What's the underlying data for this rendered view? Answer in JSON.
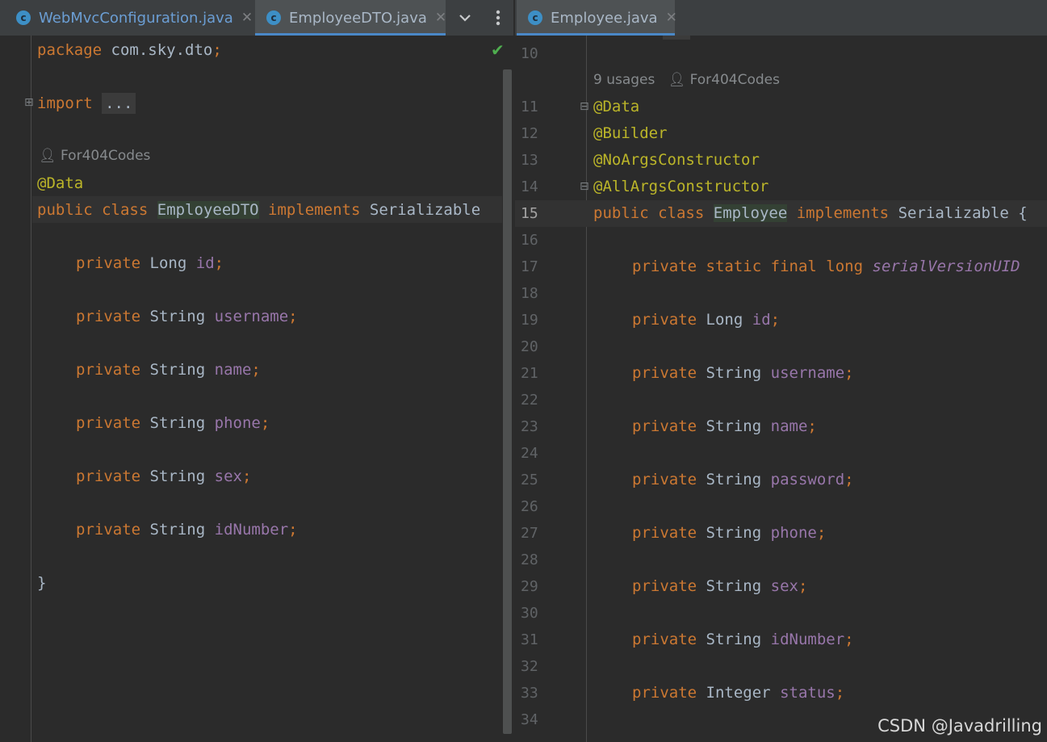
{
  "left_tabs": [
    {
      "label": "WebMvcConfiguration.java",
      "icon": "class-icon",
      "active": false
    },
    {
      "label": "EmployeeDTO.java",
      "icon": "class-icon",
      "active": true
    }
  ],
  "right_tabs": [
    {
      "label": "Employee.java",
      "icon": "class-icon",
      "active": true
    }
  ],
  "tab_icon_letter": "c",
  "close_glyph": "✕",
  "left_editor": {
    "lines": {
      "l1": {
        "kw": "package",
        "rest": " com.sky.dto",
        "semi": ";"
      },
      "l2": {
        "kw": "import",
        "fold": "..."
      },
      "l3": {
        "hint_user": "For404Codes"
      },
      "l4": {
        "ann": "@Data"
      },
      "l5": {
        "kw1": "public",
        "kw2": "class",
        "name": "EmployeeDTO",
        "kw3": "implements",
        "iface": "Serializable"
      },
      "l6": {
        "kw": "private",
        "type": "Long",
        "field": "id",
        "semi": ";"
      },
      "l7": {
        "kw": "private",
        "type": "String",
        "field": "username",
        "semi": ";"
      },
      "l8": {
        "kw": "private",
        "type": "String",
        "field": "name",
        "semi": ";"
      },
      "l9": {
        "kw": "private",
        "type": "String",
        "field": "phone",
        "semi": ";"
      },
      "l10": {
        "kw": "private",
        "type": "String",
        "field": "sex",
        "semi": ";"
      },
      "l11": {
        "kw": "private",
        "type": "String",
        "field": "idNumber",
        "semi": ";"
      },
      "l12": {
        "brace": "}"
      }
    }
  },
  "right_editor": {
    "line_numbers": [
      "10",
      "11",
      "12",
      "13",
      "14",
      "15",
      "16",
      "17",
      "18",
      "19",
      "20",
      "21",
      "22",
      "23",
      "24",
      "25",
      "26",
      "27",
      "28",
      "29",
      "30",
      "31",
      "32",
      "33",
      "34"
    ],
    "current_line": "15",
    "hint_usages": "9 usages",
    "hint_user": "For404Codes",
    "annotations": [
      "@Data",
      "@Builder",
      "@NoArgsConstructor",
      "@AllArgsConstructor"
    ],
    "class_line": {
      "kw1": "public",
      "kw2": "class",
      "name": "Employee",
      "kw3": "implements",
      "iface": "Serializable",
      "brace": "{"
    },
    "serial_line": {
      "kw1": "private",
      "kw2": "static",
      "kw3": "final",
      "kw4": "long",
      "field": "serialVersionUID"
    },
    "fields": [
      {
        "kw": "private",
        "type": "Long",
        "field": "id",
        "semi": ";"
      },
      {
        "kw": "private",
        "type": "String",
        "field": "username",
        "semi": ";"
      },
      {
        "kw": "private",
        "type": "String",
        "field": "name",
        "semi": ";"
      },
      {
        "kw": "private",
        "type": "String",
        "field": "password",
        "semi": ";"
      },
      {
        "kw": "private",
        "type": "String",
        "field": "phone",
        "semi": ";"
      },
      {
        "kw": "private",
        "type": "String",
        "field": "sex",
        "semi": ";"
      },
      {
        "kw": "private",
        "type": "String",
        "field": "idNumber",
        "semi": ";"
      },
      {
        "kw": "private",
        "type": "Integer",
        "field": "status",
        "semi": ";"
      }
    ]
  },
  "watermark": "CSDN @Javadrilling",
  "colors": {
    "keyword": "#cc7832",
    "annotation": "#bbb529",
    "field": "#9876aa",
    "text": "#a9b7c6",
    "background": "#2b2b2b",
    "check": "#4fae4f"
  }
}
